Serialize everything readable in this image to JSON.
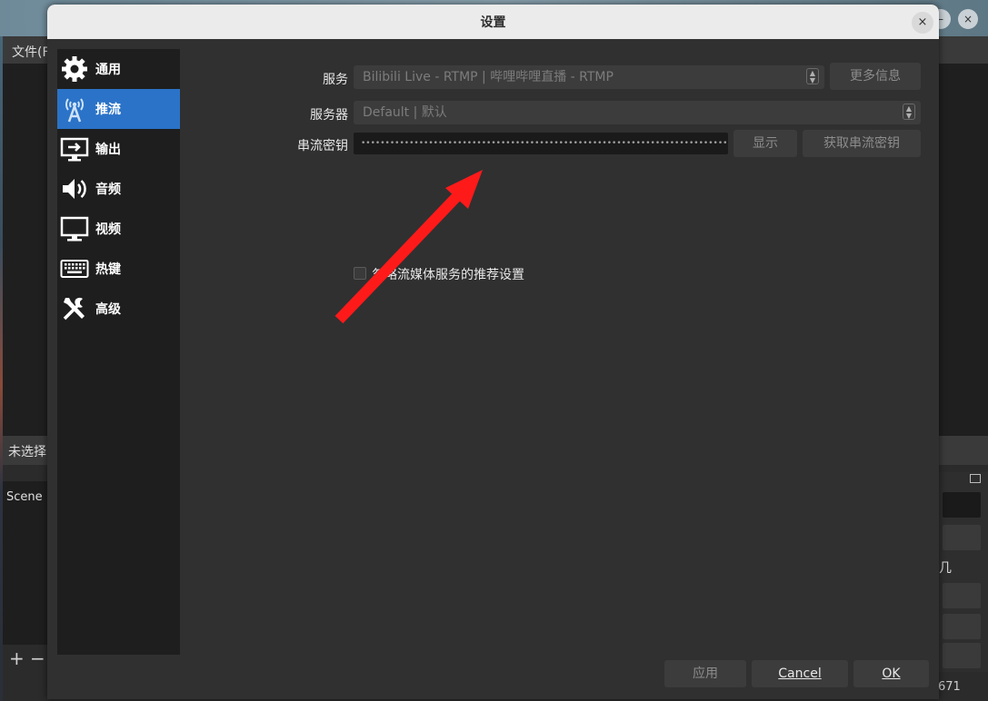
{
  "background_window": {
    "menu_file": "文件(F",
    "unselected_label": "未选择",
    "scene_label": "Scene",
    "add_symbol": "+",
    "remove_symbol": "−",
    "right_partial_text": "几",
    "right_partial_number": "671"
  },
  "dialog": {
    "title": "设置",
    "close_symbol": "×"
  },
  "sidebar": {
    "items": [
      {
        "label": "通用",
        "icon": "gear-icon",
        "active": false
      },
      {
        "label": "推流",
        "icon": "antenna-icon",
        "active": true
      },
      {
        "label": "输出",
        "icon": "output-icon",
        "active": false
      },
      {
        "label": "音频",
        "icon": "speaker-icon",
        "active": false
      },
      {
        "label": "视频",
        "icon": "monitor-icon",
        "active": false
      },
      {
        "label": "热键",
        "icon": "keyboard-icon",
        "active": false
      },
      {
        "label": "高级",
        "icon": "tools-icon",
        "active": false
      }
    ]
  },
  "stream": {
    "service_label": "服务",
    "service_value": "Bilibili Live - RTMP | 哔哩哔哩直播 - RTMP",
    "more_info_button": "更多信息",
    "server_label": "服务器",
    "server_value": "Default | 默认",
    "stream_key_label": "串流密钥",
    "stream_key_value": "••••••••••••••••••••••••••••••••••••••••••••••••••••••••••••••••••••••••••••••••••",
    "show_button": "显示",
    "get_key_button": "获取串流密钥",
    "ignore_recommendations_label": "忽略流媒体服务的推荐设置"
  },
  "footer": {
    "apply_button": "应用",
    "cancel_button": "Cancel",
    "ok_button": "OK"
  },
  "colors": {
    "accent": "#2a73c8",
    "annotation_arrow": "#ff1a1a",
    "dialog_bg": "#303030",
    "sidebar_bg": "#1e1e1e"
  }
}
